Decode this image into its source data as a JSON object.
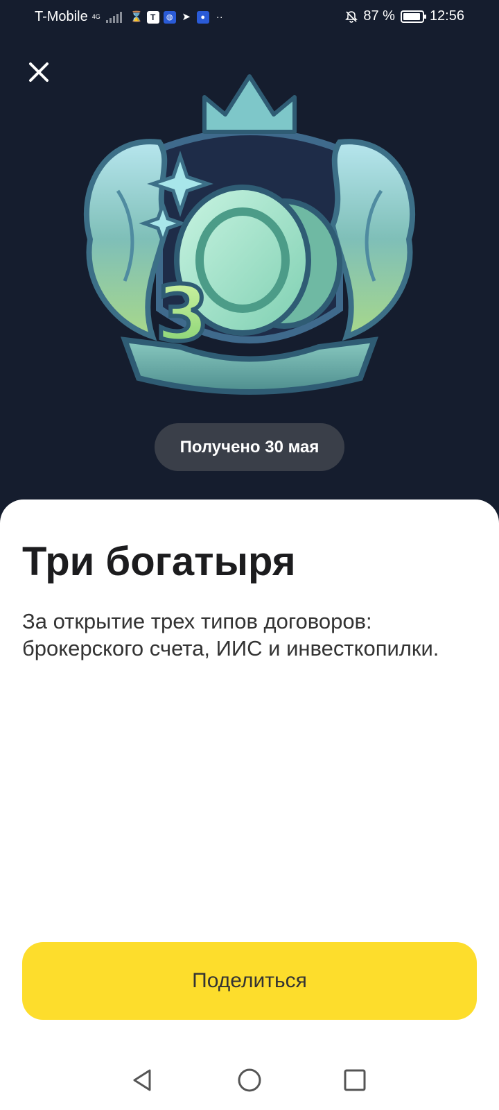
{
  "status_bar": {
    "carrier": "T-Mobile",
    "network": "4G",
    "battery_percent": "87 %",
    "time": "12:56",
    "left_icons": [
      "hourglass-icon",
      "tinkoff-icon",
      "vpn-icon",
      "telegram-icon",
      "browser-icon",
      "more-dots-icon"
    ],
    "right_icons": [
      "mute-bell-icon",
      "battery-icon"
    ]
  },
  "header": {
    "close_icon": "close-icon"
  },
  "badge": {
    "icon": "three-coins-achievement-badge",
    "digit": "3"
  },
  "achievement": {
    "received_label": "Получено 30 мая",
    "title": "Три богатыря",
    "description": "За открытие трех типов договоров: брокерского счета, ИИС и инвесткопилки."
  },
  "actions": {
    "share_label": "Поделиться"
  },
  "nav_bar": {
    "icons": [
      "back-icon",
      "home-icon",
      "recents-icon"
    ]
  },
  "colors": {
    "background_dark": "#151d2e",
    "sheet": "#ffffff",
    "pill": "#3a3f49",
    "share_button": "#fddd2c",
    "badge_accent": "#9fe3cf"
  }
}
